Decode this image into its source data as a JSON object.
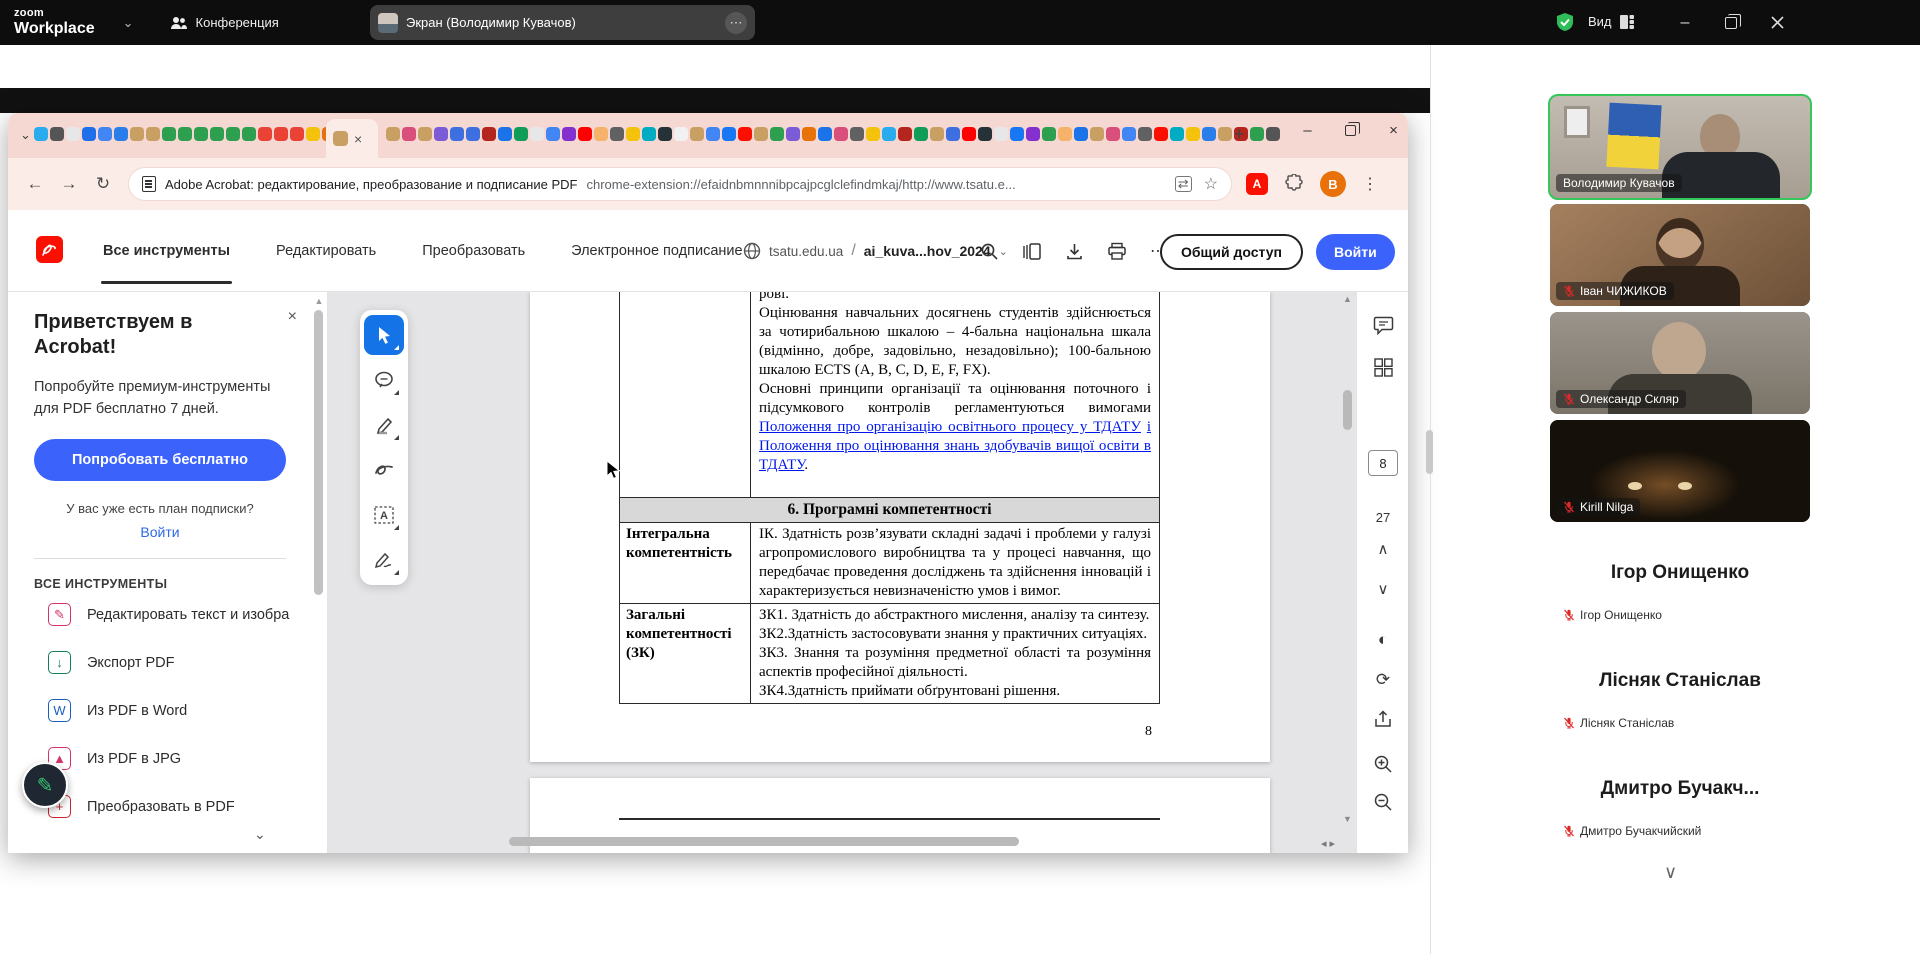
{
  "meeting": {
    "app_name_line1": "zoom",
    "app_name_line2": "Workplace",
    "meeting_tab": "Конференция",
    "screen_tab": "Экран (Володимир Кувачов)",
    "view_button": "Вид"
  },
  "browser": {
    "page_title": "Adobe Acrobat: редактирование, преобразование и подписание PDF",
    "url": "chrome-extension://efaidnbmnnnibpcajpcglclefindmkaj/http://www.tsatu.e...",
    "profile_initial": "B",
    "active_tab_favicon": "#c9a063",
    "favicons_group1": [
      "#2aabee",
      "#555555",
      "#e7e7e7",
      "#1f6feb",
      "#4285f4",
      "#2b7de9",
      "#c9a063",
      "#c9a063",
      "#2e9e4f",
      "#2e9e4f",
      "#2e9e4f",
      "#2e9e4f",
      "#2e9e4f",
      "#2e9e4f",
      "#ea4335",
      "#ea4335",
      "#ea4335",
      "#f4c20d",
      "#e8710a"
    ],
    "favicons_group2": [
      "#c9a063",
      "#d94f7c",
      "#c9a063",
      "#7b5bd6",
      "#3d6fe0",
      "#3d6fe0",
      "#b3261e",
      "#1a73e8",
      "#0f9d58",
      "#e7e7e7",
      "#4285f4",
      "#8430ce",
      "#ff0000",
      "#f6b26b",
      "#616161",
      "#f4c20d",
      "#00acc1",
      "#263238",
      "#f1f1f1",
      "#c9a063",
      "#4285f4",
      "#1877f2",
      "#fa0f00",
      "#c9a063",
      "#2e9e4f",
      "#7b5bd6",
      "#e8710a",
      "#1a73e8",
      "#d94f7c",
      "#616161",
      "#f4c20d",
      "#2aabee",
      "#b3261e",
      "#0f9d58",
      "#c9a063",
      "#3d6fe0",
      "#ff0000",
      "#263238",
      "#e7e7e7",
      "#1877f2",
      "#8430ce",
      "#2e9e4f",
      "#f6b26b",
      "#1a73e8",
      "#c9a063",
      "#d94f7c",
      "#4285f4",
      "#616161",
      "#fa0f00",
      "#00acc1",
      "#f4c20d",
      "#2b7de9",
      "#c9a063",
      "#b3261e",
      "#2e9e4f",
      "#555555"
    ]
  },
  "acrobat": {
    "menu_tabs": [
      "Все инструменты",
      "Редактировать",
      "Преобразовать",
      "Электронное подписание"
    ],
    "site_domain": "tsatu.edu.ua",
    "path_separator": "/",
    "file_name": "ai_kuva...hov_2024",
    "share_button": "Общий доступ",
    "login_button": "Войти"
  },
  "sidebar": {
    "promo_title": "Приветствуем в Acrobat!",
    "promo_body": "Попробуйте премиум-инструменты для PDF бесплатно 7 дней.",
    "trial_button": "Попробовать бесплатно",
    "plan_question": "У вас уже есть план подписки?",
    "login_link": "Войти",
    "tools_header": "ВСЕ ИНСТРУМЕНТЫ",
    "tools": [
      {
        "label": "Редактировать текст и изобра",
        "icon": "edit-text-icon",
        "color": "#d6336c",
        "glyph": "✎"
      },
      {
        "label": "Экспорт PDF",
        "icon": "export-pdf-icon",
        "color": "#12805c",
        "glyph": "↓"
      },
      {
        "label": "Из PDF в Word",
        "icon": "pdf-to-word-icon",
        "color": "#1b5ebe",
        "glyph": "W"
      },
      {
        "label": "Из PDF в JPG",
        "icon": "pdf-to-jpg-icon",
        "color": "#d6336c",
        "glyph": "▲"
      },
      {
        "label": "Преобразовать в PDF",
        "icon": "create-pdf-icon",
        "color": "#c9252d",
        "glyph": "+"
      }
    ]
  },
  "quick_tools": [
    "select-tool",
    "add-comment-tool",
    "highlight-tool",
    "draw-tool",
    "add-text-tool",
    "fill-sign-tool"
  ],
  "pdf": {
    "current_page": "8",
    "total_pages": "27",
    "page": {
      "clipped_line": "рові.",
      "paragraph1": "Оцінювання навчальних досягнень студентів здійснюється за чотирибальною шкалою – 4-бальна національна шкала (відмінно, добре, задовільно, незадовільно); 100-бальною шкалою ECTS (A, B, C, D, E, F, FX).",
      "paragraph2": "Основні принципи організації та оцінювання поточного і підсумкового контролів регламентуються вимогами",
      "link1": "Положення про організацію освітнього процесу у ТДАТУ",
      "link2": "і Положення про оцінювання знань здобувачів вищої освіти в ТДАТУ",
      "link2_suffix": ".",
      "section_header": "6. Програмні компетентності",
      "rows": [
        {
          "term": "Інтегральна компетентність",
          "definition": "ІК. Здатність розв’язувати складні задачі і проблеми у галузі агропромислового виробництва та у процесі навчання, що передбачає проведення досліджень та здійснення інновацій і характеризується невизначеністю умов і вимог."
        },
        {
          "term": "Загальні компетентності (ЗК)",
          "definition_lines": [
            "ЗК1. Здатність до абстрактного мислення, аналізу та синтезу.",
            "ЗК2.Здатність застосовувати знання у практичних ситуаціях.",
            "ЗК3. Знання та розуміння предметної області та розуміння аспектів професійної діяльності.",
            "ЗК4.Здатність приймати обґрунтовані рішення."
          ]
        }
      ],
      "page_number": "8"
    }
  },
  "participants": {
    "tiles": [
      {
        "name": "Володимир Кувачов",
        "has_video": true,
        "active_speaker": true,
        "muted": false
      },
      {
        "name": "Іван ЧИЖИКОВ",
        "has_video": true,
        "muted": true
      },
      {
        "name": "Олександр Скляр",
        "has_video": true,
        "muted": true
      },
      {
        "name": "Kirill Nilga",
        "has_video": true,
        "muted": true
      },
      {
        "name": "Ігор Онищенко",
        "display_name": "Ігор Онищенко",
        "has_video": false,
        "muted": true
      },
      {
        "name": "Лісняк Станіслав",
        "display_name": "Лісняк Станіслав",
        "has_video": false,
        "muted": true
      },
      {
        "name": "Дмитро Бучакчийский",
        "display_name": "Дмитро  Бучакч...",
        "has_video": false,
        "muted": true
      }
    ]
  },
  "icon_glyphs": {
    "chevron_down": "⌄",
    "close": "×",
    "plus": "+",
    "more_horizontal": "⋯",
    "more_vertical": "⋮",
    "back": "←",
    "forward": "→",
    "reload": "↻",
    "star": "☆",
    "translate": "⇄",
    "scroll_up": "▲",
    "scroll_down": "▼",
    "h_arrows": "◂▸",
    "page_up": "∧",
    "page_down": "∨",
    "contrast": "◐",
    "refresh": "⟳"
  },
  "colors": {
    "accent_blue": "#3b63fb",
    "adobe_red": "#fa0f00",
    "active_speaker_green": "#35c75a",
    "muted_mic_red": "#e02828",
    "link_blue": "#0018ee",
    "tabstrip_pink": "#f6d8d2",
    "addressbar_pink": "#fcece8"
  }
}
